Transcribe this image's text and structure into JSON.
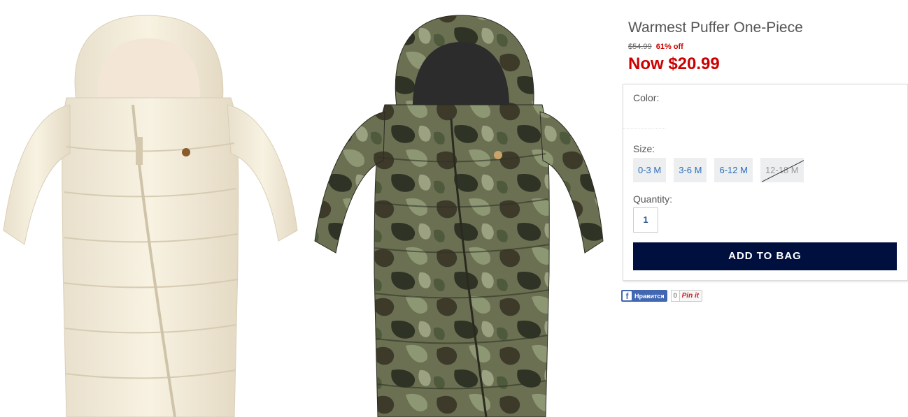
{
  "product": {
    "title": "Warmest Puffer One-Piece",
    "old_price": "$54.99",
    "discount": "61% off",
    "now_price": "Now $20.99"
  },
  "options": {
    "color_label": "Color:",
    "size_label": "Size:",
    "sizes": [
      {
        "label": "0-3 M",
        "available": true
      },
      {
        "label": "3-6 M",
        "available": true
      },
      {
        "label": "6-12 M",
        "available": true
      },
      {
        "label": "12-18 M",
        "available": false
      }
    ],
    "quantity_label": "Quantity:",
    "quantity": "1",
    "add_button": "ADD TO BAG"
  },
  "social": {
    "fb_like": "Нравится",
    "fb_count": "0",
    "pin": "Pin it"
  },
  "colors": {
    "accent_red": "#cc0000",
    "button_navy": "#00103e",
    "size_text": "#2a6ebb"
  },
  "images": [
    {
      "name": "cream puffer one-piece",
      "icon": "product-photo-cream"
    },
    {
      "name": "camo puffer one-piece",
      "icon": "product-photo-camo"
    }
  ]
}
